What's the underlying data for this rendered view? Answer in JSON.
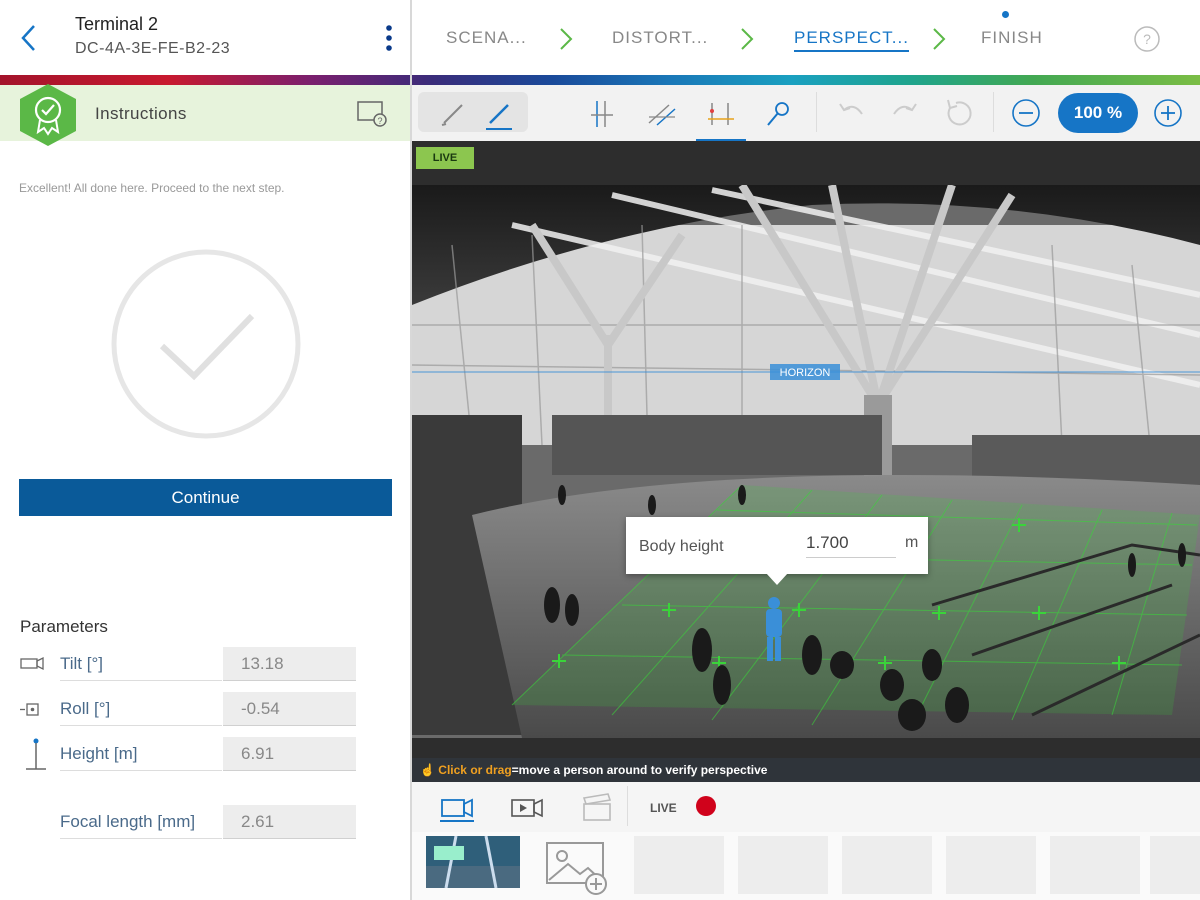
{
  "device": {
    "title": "Terminal 2",
    "subtitle": "DC-4A-3E-FE-B2-23"
  },
  "steps": [
    {
      "label": "SCENA...",
      "state": "done"
    },
    {
      "label": "DISTORT...",
      "state": "done"
    },
    {
      "label": "PERSPECT...",
      "state": "active"
    },
    {
      "label": "FINISH",
      "state": "next"
    }
  ],
  "instructions": {
    "title": "Instructions",
    "text": "Excellent! All done here. Proceed to the next step.",
    "continue_label": "Continue"
  },
  "parameters": {
    "title": "Parameters",
    "items": [
      {
        "label": "Tilt [°]",
        "value": "13.18"
      },
      {
        "label": "Roll [°]",
        "value": "-0.54"
      },
      {
        "label": "Height [m]",
        "value": "6.91"
      },
      {
        "label": "Focal length [mm]",
        "value": "2.61"
      }
    ]
  },
  "toolbar": {
    "zoom": "100 %"
  },
  "video": {
    "live_label": "LIVE",
    "horizon_label": "HORIZON",
    "hint_action": "Click or drag",
    "hint_text": "=move a person around to verify perspective"
  },
  "body_height": {
    "label": "Body height",
    "value": "1.700",
    "unit": "m"
  },
  "bottom": {
    "live_label": "LIVE"
  },
  "colors": {
    "accent": "#1675c6",
    "primary_button": "#0a5a99",
    "instructions_bg": "#e7f3dc",
    "badge": "#5bb847",
    "record": "#d0021b",
    "grid": "#3ad43a"
  }
}
